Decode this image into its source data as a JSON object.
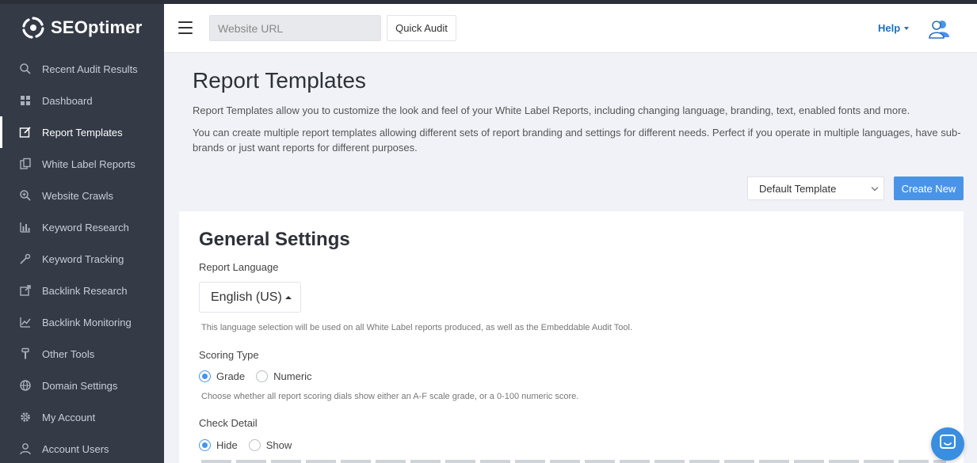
{
  "brand": {
    "name": "SEOptimer"
  },
  "sidebar": {
    "items": [
      {
        "label": "Recent Audit Results",
        "icon": "search-icon"
      },
      {
        "label": "Dashboard",
        "icon": "dashboard-icon"
      },
      {
        "label": "Report Templates",
        "icon": "edit-icon",
        "active": true
      },
      {
        "label": "White Label Reports",
        "icon": "copy-icon"
      },
      {
        "label": "Website Crawls",
        "icon": "zoom-icon"
      },
      {
        "label": "Keyword Research",
        "icon": "bar-chart-icon"
      },
      {
        "label": "Keyword Tracking",
        "icon": "tracking-icon"
      },
      {
        "label": "Backlink Research",
        "icon": "external-link-icon"
      },
      {
        "label": "Backlink Monitoring",
        "icon": "line-chart-icon"
      },
      {
        "label": "Other Tools",
        "icon": "tool-icon"
      },
      {
        "label": "Domain Settings",
        "icon": "globe-icon"
      },
      {
        "label": "My Account",
        "icon": "gear-icon"
      },
      {
        "label": "Account Users",
        "icon": "user-icon"
      }
    ]
  },
  "header": {
    "url_placeholder": "Website URL",
    "quick_audit_label": "Quick Audit",
    "help_label": "Help"
  },
  "main": {
    "title": "Report Templates",
    "description1": "Report Templates allow you to customize the look and feel of your White Label Reports, including changing language, branding, text, enabled fonts and more.",
    "description2": "You can create multiple report templates allowing different sets of report branding and settings for different needs. Perfect if you operate in multiple languages, have sub-brands or just want reports for different purposes.",
    "template_select_value": "Default Template",
    "create_new_label": "Create New"
  },
  "settings": {
    "title": "General Settings",
    "report_language_label": "Report Language",
    "report_language_value": "English (US)",
    "language_help": "This language selection will be used on all White Label reports produced, as well as the Embeddable Audit Tool.",
    "scoring_type_label": "Scoring Type",
    "scoring_options": [
      "Grade",
      "Numeric"
    ],
    "scoring_selected": "Grade",
    "scoring_help": "Choose whether all report scoring dials show either an A-F scale grade, or a 0-100 numeric score.",
    "check_detail_label": "Check Detail",
    "check_detail_options": [
      "Hide",
      "Show"
    ],
    "check_detail_selected": "Hide"
  },
  "colors": {
    "sidebar_bg": "#343a46",
    "accent": "#4a94e8",
    "help_link": "#1f6fb7",
    "page_bg": "#f0f2f7"
  }
}
